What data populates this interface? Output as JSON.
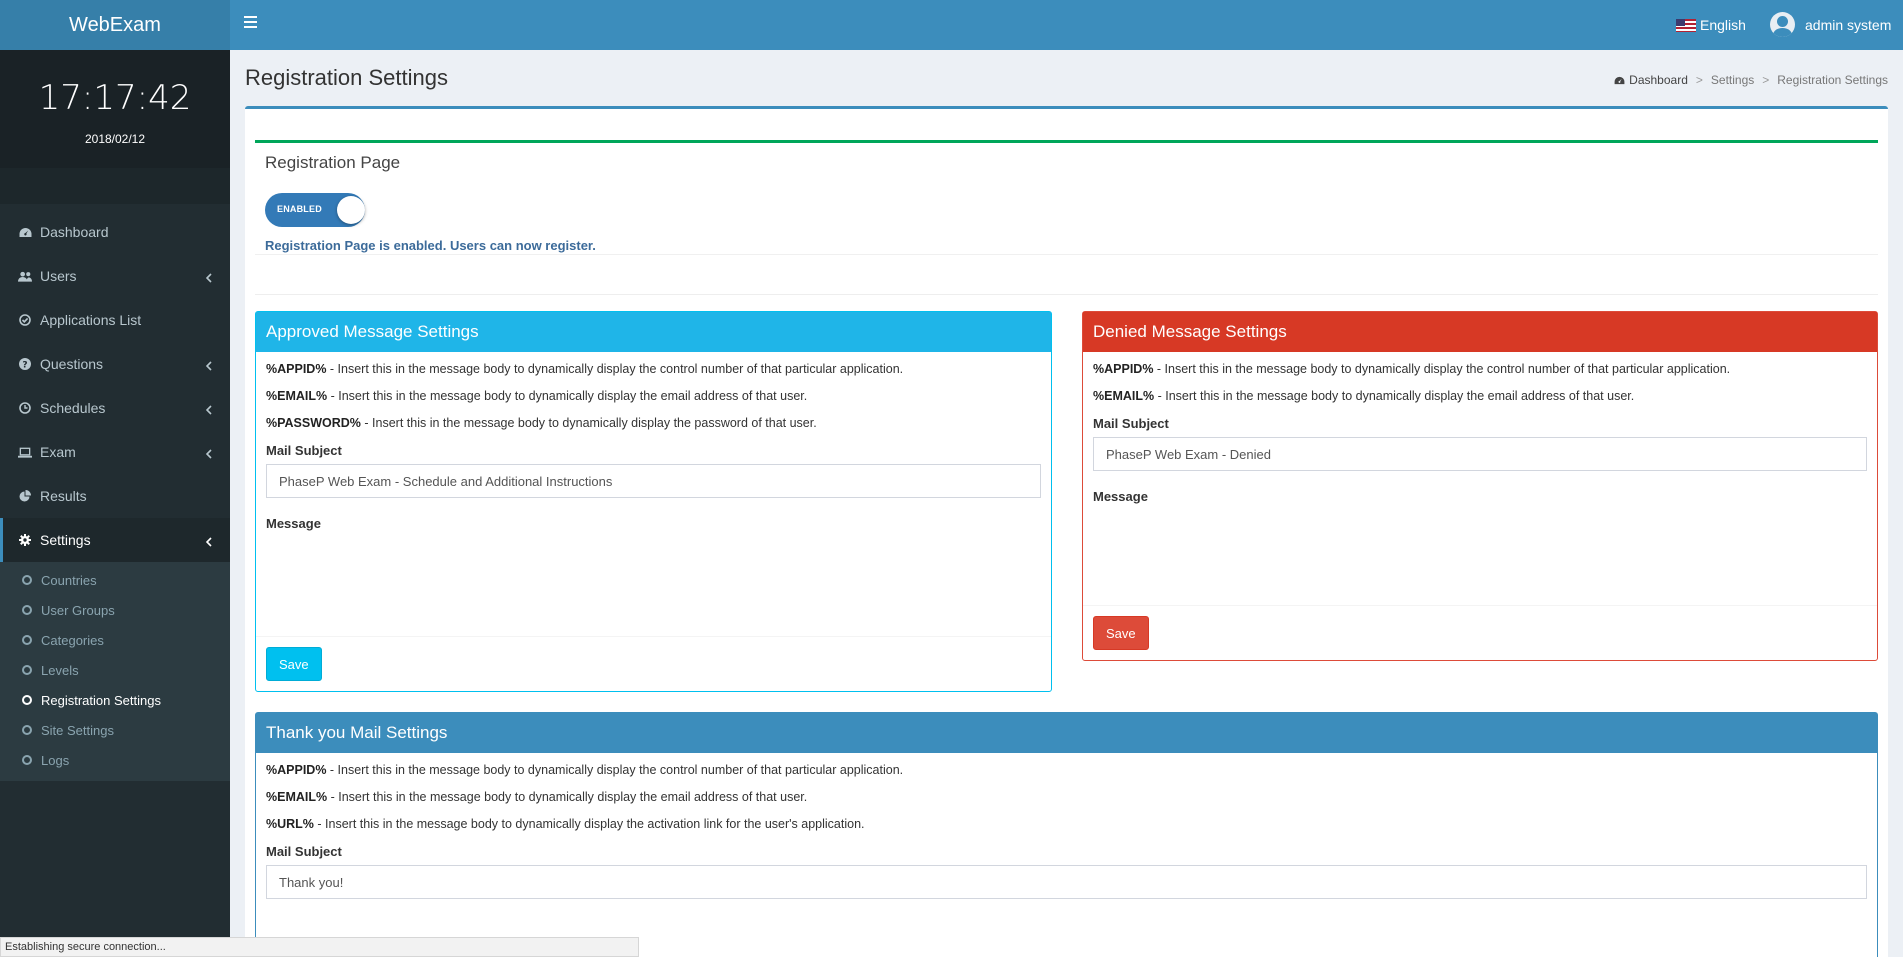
{
  "header": {
    "brand": "WebExam",
    "language": "English",
    "user_name": "admin system"
  },
  "sidebar": {
    "time": "17:17:42",
    "date": "2018/02/12",
    "menu": [
      {
        "label": "Dashboard",
        "icon": "dashboard-icon"
      },
      {
        "label": "Users",
        "icon": "users-icon"
      },
      {
        "label": "Applications List",
        "icon": "check-circle-icon"
      },
      {
        "label": "Questions",
        "icon": "question-circle-icon"
      },
      {
        "label": "Schedules",
        "icon": "clock-icon"
      },
      {
        "label": "Exam",
        "icon": "laptop-icon"
      },
      {
        "label": "Results",
        "icon": "pie-chart-icon"
      },
      {
        "label": "Settings",
        "icon": "gear-icon"
      }
    ],
    "settings_sub": [
      "Countries",
      "User Groups",
      "Categories",
      "Levels",
      "Registration Settings",
      "Site Settings",
      "Logs"
    ]
  },
  "page": {
    "title": "Registration Settings",
    "breadcrumb": [
      "Dashboard",
      "Settings",
      "Registration Settings"
    ]
  },
  "registration": {
    "title": "Registration Page",
    "toggle_label": "ENABLED",
    "status": "Registration Page is enabled. Users can now register."
  },
  "approved": {
    "title": "Approved Message Settings",
    "tokens": [
      {
        "key": "%APPID%",
        "desc": " - Insert this in the message body to dynamically display the control number of that particular application."
      },
      {
        "key": "%EMAIL%",
        "desc": " - Insert this in the message body to dynamically display the email address of that user."
      },
      {
        "key": "%PASSWORD%",
        "desc": " - Insert this in the message body to dynamically display the password of that user."
      }
    ],
    "subject_label": "Mail Subject",
    "subject_value": "PhaseP Web Exam - Schedule and Additional Instructions",
    "message_label": "Message",
    "save": "Save"
  },
  "denied": {
    "title": "Denied Message Settings",
    "tokens": [
      {
        "key": "%APPID%",
        "desc": " - Insert this in the message body to dynamically display the control number of that particular application."
      },
      {
        "key": "%EMAIL%",
        "desc": " - Insert this in the message body to dynamically display the email address of that user."
      }
    ],
    "subject_label": "Mail Subject",
    "subject_value": "PhaseP Web Exam - Denied",
    "message_label": "Message",
    "save": "Save"
  },
  "thanks": {
    "title": "Thank you Mail Settings",
    "tokens": [
      {
        "key": "%APPID%",
        "desc": " - Insert this in the message body to dynamically display the control number of that particular application."
      },
      {
        "key": "%EMAIL%",
        "desc": " - Insert this in the message body to dynamically display the email address of that user."
      },
      {
        "key": "%URL%",
        "desc": " - Insert this in the message body to dynamically display the activation link for the user's application."
      }
    ],
    "subject_label": "Mail Subject",
    "subject_value": "Thank you!"
  },
  "status_bar": "Establishing secure connection...",
  "colors": {
    "primary": "#3c8dbc",
    "info": "#00c0ef",
    "danger": "#dd4b39",
    "success": "#00a65a",
    "sidebar": "#222d32"
  }
}
